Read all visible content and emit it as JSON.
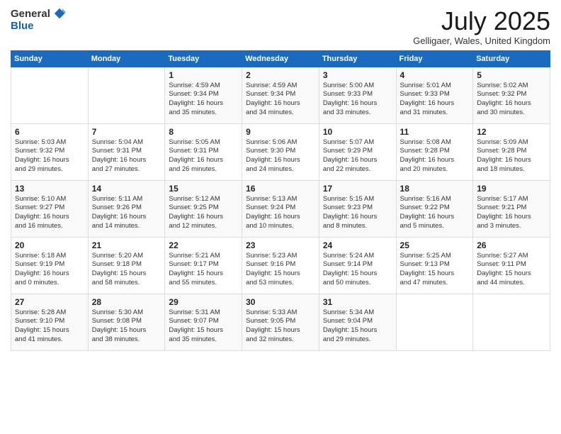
{
  "logo": {
    "general": "General",
    "blue": "Blue"
  },
  "title": "July 2025",
  "location": "Gelligaer, Wales, United Kingdom",
  "weekdays": [
    "Sunday",
    "Monday",
    "Tuesday",
    "Wednesday",
    "Thursday",
    "Friday",
    "Saturday"
  ],
  "weeks": [
    [
      {
        "day": "",
        "info": ""
      },
      {
        "day": "",
        "info": ""
      },
      {
        "day": "1",
        "info": "Sunrise: 4:59 AM\nSunset: 9:34 PM\nDaylight: 16 hours\nand 35 minutes."
      },
      {
        "day": "2",
        "info": "Sunrise: 4:59 AM\nSunset: 9:34 PM\nDaylight: 16 hours\nand 34 minutes."
      },
      {
        "day": "3",
        "info": "Sunrise: 5:00 AM\nSunset: 9:33 PM\nDaylight: 16 hours\nand 33 minutes."
      },
      {
        "day": "4",
        "info": "Sunrise: 5:01 AM\nSunset: 9:33 PM\nDaylight: 16 hours\nand 31 minutes."
      },
      {
        "day": "5",
        "info": "Sunrise: 5:02 AM\nSunset: 9:32 PM\nDaylight: 16 hours\nand 30 minutes."
      }
    ],
    [
      {
        "day": "6",
        "info": "Sunrise: 5:03 AM\nSunset: 9:32 PM\nDaylight: 16 hours\nand 29 minutes."
      },
      {
        "day": "7",
        "info": "Sunrise: 5:04 AM\nSunset: 9:31 PM\nDaylight: 16 hours\nand 27 minutes."
      },
      {
        "day": "8",
        "info": "Sunrise: 5:05 AM\nSunset: 9:31 PM\nDaylight: 16 hours\nand 26 minutes."
      },
      {
        "day": "9",
        "info": "Sunrise: 5:06 AM\nSunset: 9:30 PM\nDaylight: 16 hours\nand 24 minutes."
      },
      {
        "day": "10",
        "info": "Sunrise: 5:07 AM\nSunset: 9:29 PM\nDaylight: 16 hours\nand 22 minutes."
      },
      {
        "day": "11",
        "info": "Sunrise: 5:08 AM\nSunset: 9:28 PM\nDaylight: 16 hours\nand 20 minutes."
      },
      {
        "day": "12",
        "info": "Sunrise: 5:09 AM\nSunset: 9:28 PM\nDaylight: 16 hours\nand 18 minutes."
      }
    ],
    [
      {
        "day": "13",
        "info": "Sunrise: 5:10 AM\nSunset: 9:27 PM\nDaylight: 16 hours\nand 16 minutes."
      },
      {
        "day": "14",
        "info": "Sunrise: 5:11 AM\nSunset: 9:26 PM\nDaylight: 16 hours\nand 14 minutes."
      },
      {
        "day": "15",
        "info": "Sunrise: 5:12 AM\nSunset: 9:25 PM\nDaylight: 16 hours\nand 12 minutes."
      },
      {
        "day": "16",
        "info": "Sunrise: 5:13 AM\nSunset: 9:24 PM\nDaylight: 16 hours\nand 10 minutes."
      },
      {
        "day": "17",
        "info": "Sunrise: 5:15 AM\nSunset: 9:23 PM\nDaylight: 16 hours\nand 8 minutes."
      },
      {
        "day": "18",
        "info": "Sunrise: 5:16 AM\nSunset: 9:22 PM\nDaylight: 16 hours\nand 5 minutes."
      },
      {
        "day": "19",
        "info": "Sunrise: 5:17 AM\nSunset: 9:21 PM\nDaylight: 16 hours\nand 3 minutes."
      }
    ],
    [
      {
        "day": "20",
        "info": "Sunrise: 5:18 AM\nSunset: 9:19 PM\nDaylight: 16 hours\nand 0 minutes."
      },
      {
        "day": "21",
        "info": "Sunrise: 5:20 AM\nSunset: 9:18 PM\nDaylight: 15 hours\nand 58 minutes."
      },
      {
        "day": "22",
        "info": "Sunrise: 5:21 AM\nSunset: 9:17 PM\nDaylight: 15 hours\nand 55 minutes."
      },
      {
        "day": "23",
        "info": "Sunrise: 5:23 AM\nSunset: 9:16 PM\nDaylight: 15 hours\nand 53 minutes."
      },
      {
        "day": "24",
        "info": "Sunrise: 5:24 AM\nSunset: 9:14 PM\nDaylight: 15 hours\nand 50 minutes."
      },
      {
        "day": "25",
        "info": "Sunrise: 5:25 AM\nSunset: 9:13 PM\nDaylight: 15 hours\nand 47 minutes."
      },
      {
        "day": "26",
        "info": "Sunrise: 5:27 AM\nSunset: 9:11 PM\nDaylight: 15 hours\nand 44 minutes."
      }
    ],
    [
      {
        "day": "27",
        "info": "Sunrise: 5:28 AM\nSunset: 9:10 PM\nDaylight: 15 hours\nand 41 minutes."
      },
      {
        "day": "28",
        "info": "Sunrise: 5:30 AM\nSunset: 9:08 PM\nDaylight: 15 hours\nand 38 minutes."
      },
      {
        "day": "29",
        "info": "Sunrise: 5:31 AM\nSunset: 9:07 PM\nDaylight: 15 hours\nand 35 minutes."
      },
      {
        "day": "30",
        "info": "Sunrise: 5:33 AM\nSunset: 9:05 PM\nDaylight: 15 hours\nand 32 minutes."
      },
      {
        "day": "31",
        "info": "Sunrise: 5:34 AM\nSunset: 9:04 PM\nDaylight: 15 hours\nand 29 minutes."
      },
      {
        "day": "",
        "info": ""
      },
      {
        "day": "",
        "info": ""
      }
    ]
  ]
}
